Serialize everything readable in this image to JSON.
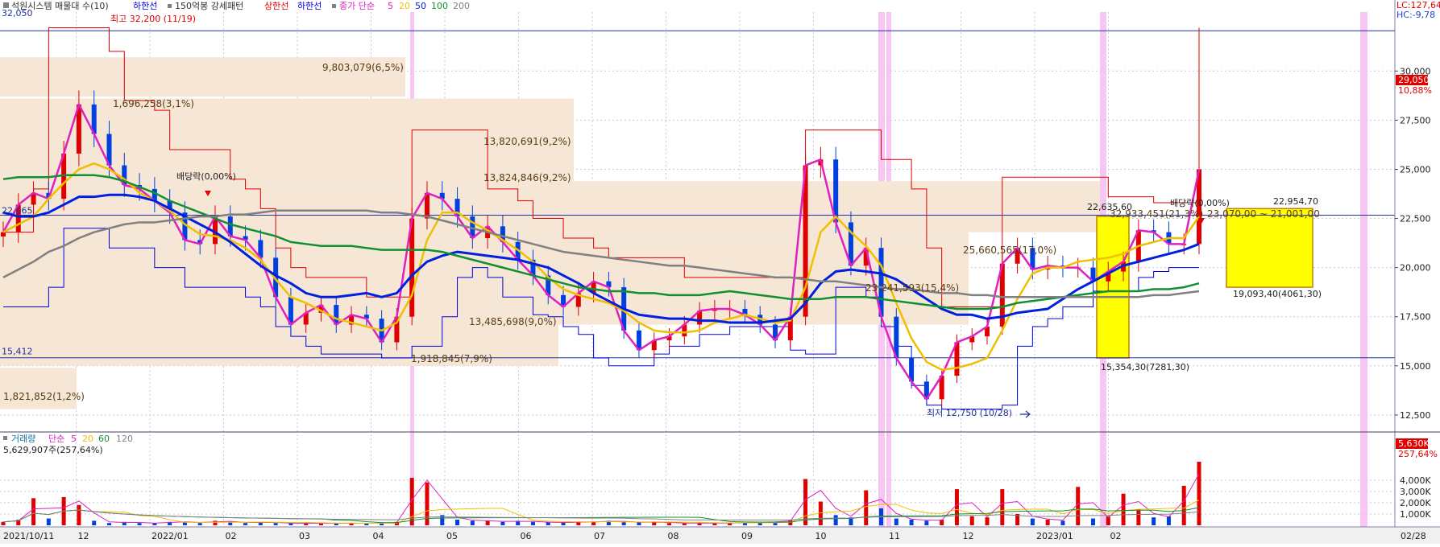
{
  "colors": {
    "background": "#ffffff",
    "axis_bg": "#f0f0f0",
    "grid": "#c8c8d8",
    "band": "#f5e6d6",
    "band_text": "#5a3c14",
    "highlight_box": "#ffff00",
    "highlight_edge": "#c08000",
    "ma5": "#e020c0",
    "ma20": "#f0c000",
    "ma50": "#0020e0",
    "ma100": "#109030",
    "ma200": "#808080",
    "upper_limit": "#e00000",
    "lower_limit": "#0000e0",
    "up_candle": "#e00000",
    "down_candle": "#0040e0",
    "vol_ma5": "#e020c0",
    "vol_ma20": "#f0c000",
    "vol_ma60": "#109030",
    "vol_ma120": "#808080",
    "tag_red": "#e00000",
    "tag_blue": "#2040d0",
    "pink_stripe": "#f5b8f0"
  },
  "price_legend": {
    "checkbox_icon": "square-icon",
    "title": "석원시스템 매물대 수(10)",
    "lower_label": "하한선",
    "pattern_label": "150억봉 강세패턴",
    "upper_label": "상한선",
    "lower_label2": "하한선",
    "ma_label": "종가 단순",
    "ma_periods": [
      "5",
      "20",
      "50",
      "100",
      "200"
    ]
  },
  "volume_legend": {
    "title": "거래량",
    "ma_label": "단순",
    "ma_periods": [
      "5",
      "20",
      "60",
      "120"
    ],
    "current_value": "5,629,907주(257,64%)"
  },
  "right_tags": {
    "lc": "LC:127,64",
    "hc": "HC:-9,78",
    "last_price": "29,050",
    "last_change": "10,88%",
    "last_volume": "5,630K",
    "volume_ratio": "257,64%"
  },
  "annotations": {
    "ref_high": "32,050",
    "ref_mid": "22,665",
    "ref_low": "15,412",
    "max_label": "최고 32,200 (11/19)",
    "min_label": "최저 12,750 (10/28)",
    "div1": "배당락(0,00%)",
    "div2": "배당락(0,00%)",
    "box_high": "22,635,60",
    "box_low": "15,354,30(7281,30)",
    "box2_high": "22,954,70",
    "box2_low": "19,093,40(4061,30)",
    "box2_range": "23,070,00 ~ 21,001,00",
    "band_upper_label": "32,933,451(21,3%)"
  },
  "volume_profile": [
    {
      "label": "9,803,079(6,5%)"
    },
    {
      "label": "1,696,258(3,1%)"
    },
    {
      "label": "13,820,691(9,2%)"
    },
    {
      "label": "13,824,846(9,2%)"
    },
    {
      "label": "25,660,565(17,0%)"
    },
    {
      "label": "23,241,593(15,4%)"
    },
    {
      "label": "13,485,698(9,0%)"
    },
    {
      "label": "1,918,845(7,9%)"
    },
    {
      "label": "1,821,852(1,2%)"
    }
  ],
  "chart_data": {
    "type": "candlestick",
    "price_axis": {
      "ticks": [
        12500,
        15000,
        17500,
        20000,
        22500,
        25000,
        27500,
        30000
      ],
      "tick_labels": [
        "12,500",
        "15,000",
        "17,500",
        "20,000",
        "22,500",
        "25,000",
        "27,500",
        "30,000"
      ],
      "ylim": [
        11800,
        33000
      ]
    },
    "volume_axis": {
      "ticks": [
        1000,
        2000,
        3000,
        4000
      ],
      "tick_labels": [
        "1,000K",
        "2,000K",
        "3,000K",
        "4,000K"
      ],
      "ylim": [
        0,
        6200
      ]
    },
    "x_axis_labels": [
      "2021/10/11",
      "12",
      "2022/01",
      "02",
      "03",
      "04",
      "05",
      "06",
      "07",
      "08",
      "09",
      "10",
      "11",
      "12",
      "2023/01",
      "02",
      "02/28"
    ],
    "ma_series": [
      "5",
      "20",
      "50",
      "100",
      "200"
    ],
    "series": [
      {
        "name": "5",
        "values": [
          21800,
          23200,
          23800,
          23500,
          25800,
          28300,
          26800,
          25200,
          24200,
          24000,
          23400,
          22800,
          21400,
          21200,
          22600,
          21600,
          21400,
          20500,
          18500,
          17100,
          17700,
          18100,
          17100,
          17600,
          17400,
          16200,
          17500,
          22500,
          23800,
          23500,
          22600,
          21500,
          22100,
          21300,
          20400,
          19600,
          18600,
          18000,
          18700,
          19300,
          19000,
          16800,
          15800,
          16300,
          16500,
          17100,
          17800,
          17900,
          17900,
          17600,
          17100,
          16300,
          17500,
          25200,
          25500,
          22300,
          20100,
          21000,
          17500,
          15400,
          14200,
          13300,
          14500,
          16200,
          16500,
          17000,
          20200,
          21000,
          19900,
          20100,
          20000,
          20000,
          19300,
          19800,
          20300,
          21900,
          21800,
          21200,
          21200,
          25000
        ]
      },
      {
        "name": "20",
        "values": [
          21800,
          22200,
          22600,
          23500,
          24300,
          25000,
          25300,
          25000,
          24500,
          23800,
          23400,
          22900,
          22200,
          21700,
          21600,
          21400,
          21000,
          20400,
          19400,
          18500,
          18200,
          17800,
          17400,
          17200,
          17000,
          16800,
          17200,
          18600,
          21400,
          22800,
          22800,
          22300,
          21900,
          21400,
          20900,
          20300,
          19500,
          18900,
          18600,
          18400,
          18200,
          17800,
          17200,
          16800,
          16700,
          16700,
          16800,
          17200,
          17400,
          17600,
          17400,
          17200,
          17300,
          19000,
          21800,
          22600,
          21800,
          21100,
          20100,
          18200,
          16400,
          15200,
          14800,
          14900,
          15100,
          15400,
          16800,
          18400,
          19700,
          20000,
          20000,
          20300,
          20400,
          20500,
          20700,
          21100,
          21300,
          21500,
          21500,
          22600
        ]
      },
      {
        "name": "50",
        "values": [
          22800,
          22600,
          22600,
          22800,
          23200,
          23600,
          23600,
          23700,
          23700,
          23600,
          23400,
          23000,
          22600,
          22200,
          21800,
          21300,
          20700,
          20100,
          19600,
          19200,
          18700,
          18500,
          18500,
          18600,
          18700,
          18500,
          18700,
          19600,
          20300,
          20600,
          20800,
          20700,
          20600,
          20500,
          20400,
          20200,
          20000,
          19600,
          19200,
          18700,
          18300,
          17900,
          17600,
          17500,
          17400,
          17400,
          17300,
          17300,
          17200,
          17200,
          17200,
          17300,
          17400,
          18200,
          19200,
          19800,
          19900,
          19800,
          19700,
          19400,
          18900,
          18400,
          17900,
          17600,
          17600,
          17400,
          17500,
          17700,
          17800,
          17900,
          18400,
          18900,
          19300,
          19700,
          20100,
          20300,
          20500,
          20700,
          20900,
          21200
        ]
      },
      {
        "name": "100",
        "values": [
          24500,
          24600,
          24600,
          24600,
          24700,
          24700,
          24700,
          24600,
          24400,
          24100,
          23800,
          23400,
          23100,
          22800,
          22500,
          22200,
          22000,
          21800,
          21600,
          21300,
          21200,
          21100,
          21100,
          21100,
          21000,
          20900,
          20900,
          20900,
          20900,
          20800,
          20600,
          20400,
          20200,
          20000,
          19800,
          19600,
          19400,
          19200,
          19000,
          18900,
          18800,
          18800,
          18700,
          18700,
          18600,
          18600,
          18600,
          18700,
          18800,
          18700,
          18600,
          18500,
          18400,
          18400,
          18400,
          18500,
          18500,
          18500,
          18400,
          18300,
          18200,
          18100,
          18000,
          17900,
          17900,
          17900,
          18000,
          18200,
          18300,
          18400,
          18500,
          18600,
          18700,
          18800,
          18800,
          18800,
          18900,
          18900,
          19000,
          19200
        ]
      },
      {
        "name": "200",
        "values": [
          19500,
          19900,
          20300,
          20800,
          21100,
          21500,
          21800,
          22000,
          22200,
          22300,
          22300,
          22400,
          22500,
          22600,
          22600,
          22700,
          22700,
          22800,
          22900,
          22900,
          22900,
          22900,
          22900,
          22900,
          22900,
          22800,
          22800,
          22700,
          22600,
          22400,
          22200,
          22000,
          21800,
          21600,
          21400,
          21200,
          21000,
          20800,
          20700,
          20600,
          20500,
          20400,
          20300,
          20200,
          20100,
          20100,
          20000,
          19900,
          19800,
          19700,
          19600,
          19500,
          19500,
          19400,
          19300,
          19300,
          19200,
          19100,
          19000,
          18900,
          18900,
          18800,
          18700,
          18700,
          18600,
          18600,
          18500,
          18500,
          18500,
          18500,
          18500,
          18500,
          18500,
          18500,
          18500,
          18500,
          18600,
          18600,
          18700,
          18800
        ]
      }
    ],
    "upper_line": [
      21800,
      21800,
      24000,
      32200,
      32200,
      32200,
      32200,
      31000,
      28500,
      28500,
      28000,
      26000,
      26000,
      26000,
      26000,
      24500,
      24000,
      23000,
      21000,
      20000,
      19500,
      19500,
      19500,
      19500,
      18500,
      18500,
      18500,
      27000,
      27000,
      27000,
      27000,
      27000,
      24000,
      24000,
      23400,
      22500,
      22500,
      21500,
      21500,
      21000,
      20500,
      20500,
      20500,
      20500,
      20500,
      19500,
      19500,
      19500,
      19500,
      19500,
      19500,
      19500,
      19500,
      27000,
      27000,
      27000,
      27000,
      27000,
      25500,
      25500,
      24000,
      21000,
      18000,
      18000,
      18000,
      18000,
      24600,
      24600,
      24600,
      24600,
      24600,
      24600,
      24600,
      23600,
      23600,
      23600,
      23300,
      23300,
      23300,
      32200
    ],
    "lower_line": [
      18000,
      18000,
      18000,
      19000,
      22000,
      22000,
      22000,
      21000,
      21000,
      21000,
      20000,
      20000,
      19000,
      19000,
      19000,
      19000,
      18500,
      18000,
      17000,
      16500,
      16000,
      15600,
      15600,
      15600,
      15600,
      15400,
      15400,
      16000,
      16000,
      17500,
      19500,
      20000,
      19500,
      18500,
      18500,
      17600,
      17500,
      17000,
      16600,
      15400,
      15000,
      15000,
      15000,
      15600,
      16000,
      16000,
      16600,
      16600,
      17000,
      17000,
      17000,
      17000,
      15800,
      15600,
      15600,
      19000,
      19000,
      18500,
      17000,
      16000,
      14000,
      13000,
      12800,
      12800,
      12800,
      12800,
      13000,
      16000,
      17000,
      17400,
      18000,
      18000,
      18800,
      18800,
      18800,
      19500,
      19800,
      20000,
      20000,
      20000
    ],
    "volume": [
      300,
      500,
      2400,
      600,
      2500,
      1800,
      400,
      200,
      300,
      200,
      200,
      300,
      300,
      200,
      400,
      300,
      200,
      300,
      200,
      200,
      150,
      200,
      150,
      200,
      150,
      200,
      300,
      4200,
      3800,
      900,
      500,
      400,
      400,
      300,
      400,
      300,
      250,
      250,
      300,
      300,
      400,
      300,
      250,
      300,
      200,
      200,
      200,
      200,
      200,
      250,
      300,
      300,
      450,
      4100,
      2100,
      900,
      700,
      3100,
      1500,
      600,
      500,
      400,
      500,
      3200,
      800,
      700,
      3200,
      1000,
      600,
      500,
      400,
      3400,
      600,
      800,
      2800,
      1400,
      700,
      800,
      3500,
      5630
    ]
  }
}
